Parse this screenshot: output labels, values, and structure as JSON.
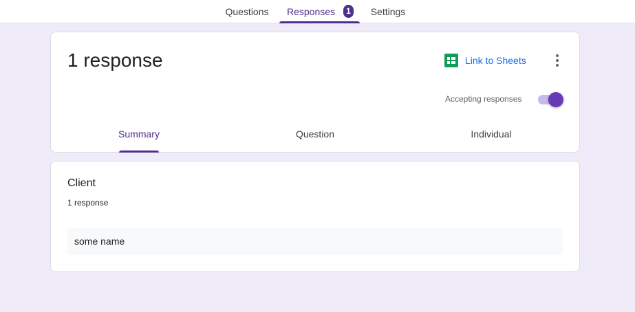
{
  "nav": {
    "tabs": [
      {
        "label": "Questions"
      },
      {
        "label": "Responses",
        "badge": "1"
      },
      {
        "label": "Settings"
      }
    ],
    "active_tab": "Responses"
  },
  "header": {
    "title": "1 response",
    "link_to_sheets_label": "Link to Sheets",
    "accepting_label": "Accepting responses",
    "accepting_enabled": true,
    "subtabs": [
      {
        "label": "Summary"
      },
      {
        "label": "Question"
      },
      {
        "label": "Individual"
      }
    ],
    "active_subtab": "Summary"
  },
  "question": {
    "title": "Client",
    "response_count": "1 response",
    "answers": [
      "some name"
    ]
  },
  "colors": {
    "accent": "#4d2f8f",
    "toggle": "#673ab7",
    "link": "#1a73e8",
    "background": "#f0ebf8",
    "sheets_green": "#0f9d58"
  },
  "icons": [
    "sheets-icon",
    "more-vert-icon"
  ]
}
